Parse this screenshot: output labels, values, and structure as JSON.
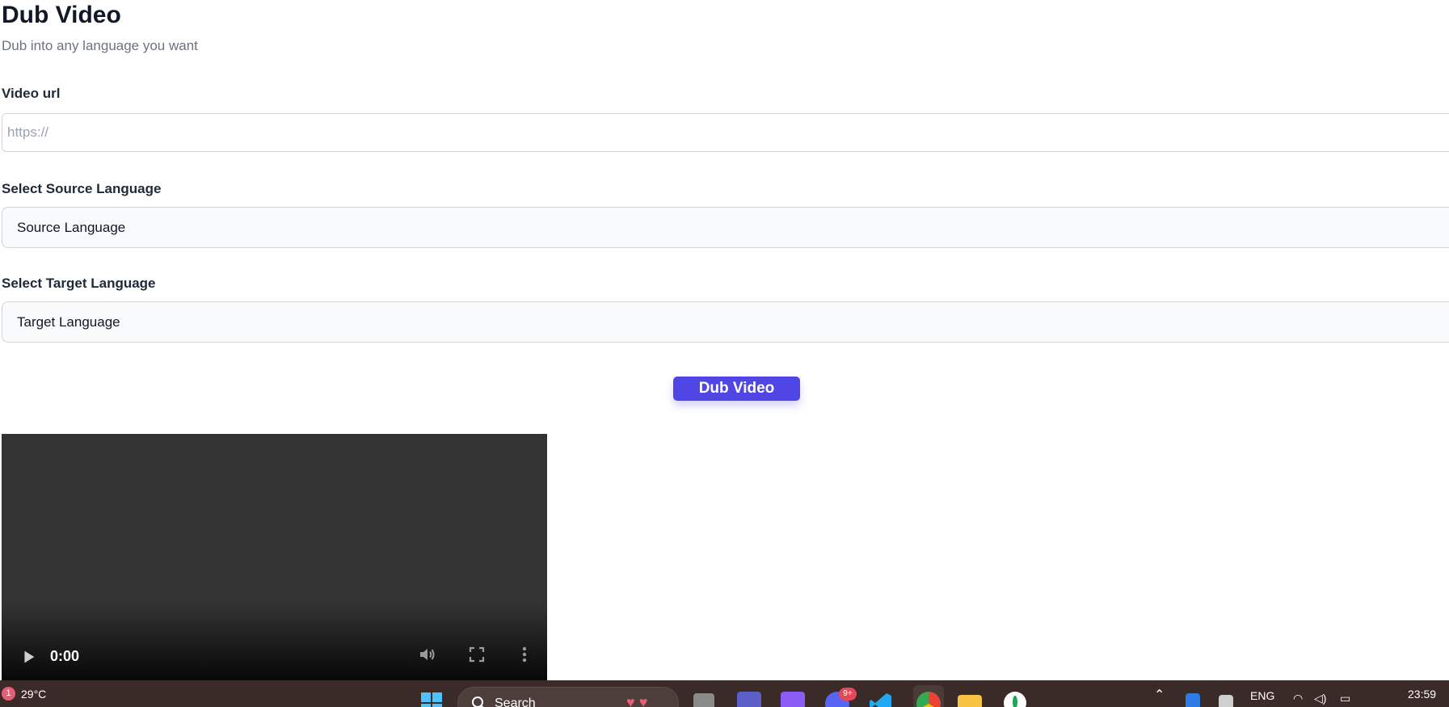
{
  "header": {
    "title": "Dub Video",
    "subtitle": "Dub into any language you want"
  },
  "form": {
    "video_url_label": "Video url",
    "video_url_placeholder": "https://",
    "video_url_value": "",
    "source_label": "Select Source Language",
    "source_value": "Source Language",
    "target_label": "Select Target Language",
    "target_value": "Target Language",
    "submit_label": "Dub Video"
  },
  "video": {
    "time": "0:00",
    "icons": [
      "play-icon",
      "volume-icon",
      "fullscreen-icon",
      "more-icon"
    ]
  },
  "taskbar": {
    "weather_badge": "1",
    "temperature": "29°C",
    "search_label": "Search",
    "notification_badge": "9+",
    "language": "ENG",
    "clock": "23:59",
    "apps": [
      "start-icon",
      "search-icon",
      "task-view-icon",
      "teams-icon",
      "clipchamp-icon",
      "discord-icon",
      "vscode-icon",
      "chrome-icon",
      "file-explorer-icon",
      "mongodb-icon"
    ]
  },
  "colors": {
    "accent": "#4f46e5",
    "video_bg": "#333333",
    "taskbar_bg": "#3a2a28",
    "subtitle": "#6b7280"
  }
}
